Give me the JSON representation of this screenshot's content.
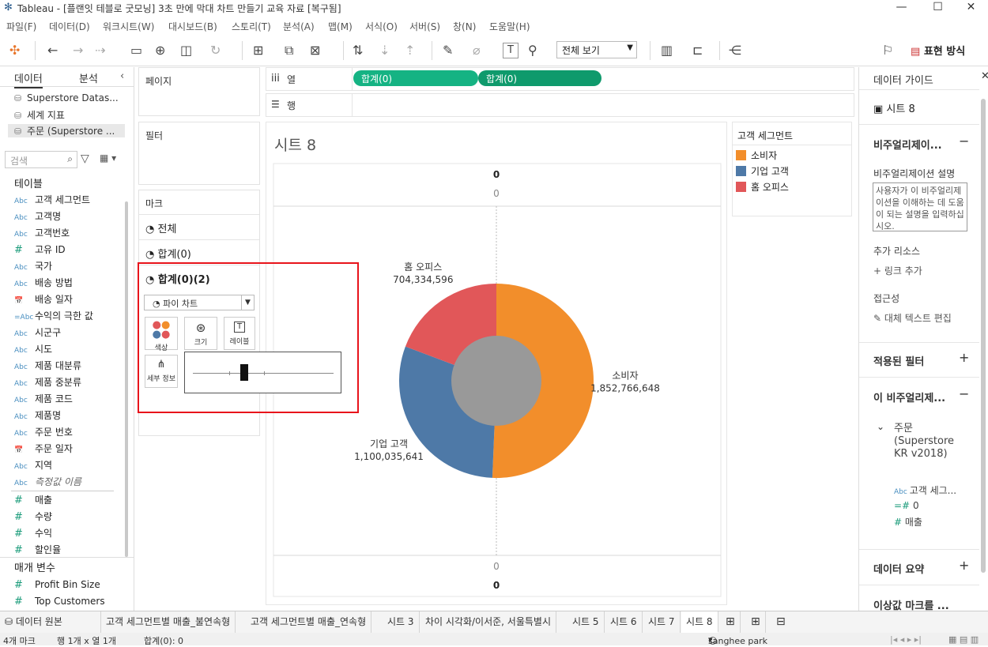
{
  "window": {
    "title": "Tableau - [플랜잇 테블로 굿모닝] 3초 만에 막대 차트 만들기 교육 자료 [복구됨]",
    "min": "—",
    "max": "☐",
    "close": "✕"
  },
  "menu": [
    "파일(F)",
    "데이터(D)",
    "워크시트(W)",
    "대시보드(B)",
    "스토리(T)",
    "분석(A)",
    "맵(M)",
    "서식(O)",
    "서버(S)",
    "창(N)",
    "도움말(H)"
  ],
  "toolbar": {
    "view_select": "전체 보기",
    "show_me": "표현 방식"
  },
  "datapane": {
    "tab_data": "데이터",
    "tab_analysis": "분석",
    "sources": [
      "Superstore Datas...",
      "세계 지표",
      "주문 (Superstore ..."
    ],
    "search_placeholder": "검색",
    "tables_header": "테이블",
    "dimensions": [
      {
        "type": "Abc",
        "name": "고객 세그먼트"
      },
      {
        "type": "Abc",
        "name": "고객명"
      },
      {
        "type": "Abc",
        "name": "고객번호"
      },
      {
        "type": "#",
        "name": "고유 ID"
      },
      {
        "type": "Abc",
        "name": "국가"
      },
      {
        "type": "Abc",
        "name": "배송 방법"
      },
      {
        "type": "📅",
        "name": "배송 일자"
      },
      {
        "type": "=Abc",
        "name": "수익의 극한 값"
      },
      {
        "type": "Abc",
        "name": "시군구"
      },
      {
        "type": "Abc",
        "name": "시도"
      },
      {
        "type": "Abc",
        "name": "제품 대분류"
      },
      {
        "type": "Abc",
        "name": "제품 중분류"
      },
      {
        "type": "Abc",
        "name": "제품 코드"
      },
      {
        "type": "Abc",
        "name": "제품명"
      },
      {
        "type": "Abc",
        "name": "주문 번호"
      },
      {
        "type": "📅",
        "name": "주문 일자"
      },
      {
        "type": "Abc",
        "name": "지역"
      },
      {
        "type": "Abc",
        "name": "측정값 이름"
      }
    ],
    "measures": [
      {
        "type": "#",
        "name": "매출"
      },
      {
        "type": "#",
        "name": "수량"
      },
      {
        "type": "#",
        "name": "수익"
      },
      {
        "type": "#",
        "name": "할인율"
      }
    ],
    "params_header": "매개 변수",
    "params": [
      {
        "type": "#",
        "name": "Profit Bin Size"
      },
      {
        "type": "#",
        "name": "Top Customers"
      }
    ]
  },
  "shelves": {
    "pages": "페이지",
    "filters": "필터",
    "marks": "마크",
    "marks_all": "전체",
    "marks_sum0": "합계(0)",
    "marks_sum0_2": "합계(0)(2)",
    "mark_type": "파이 차트",
    "btn_color": "색상",
    "btn_size": "크기",
    "btn_label": "레이블",
    "btn_detail": "세부 정보",
    "columns_label": "열",
    "rows_label": "행",
    "col_pill_1": "합계(0)",
    "col_pill_2": "합계(0)"
  },
  "view": {
    "sheet_title": "시트 8",
    "axis_top_1": "0",
    "axis_top_2": "0",
    "axis_bottom_1": "0",
    "axis_bottom_2": "0"
  },
  "chart_data": {
    "type": "pie",
    "categories": [
      "소비자",
      "기업 고객",
      "홈 오피스"
    ],
    "values": [
      1852766648,
      1100035641,
      704334596
    ],
    "value_labels": [
      "1,852,766,648",
      "1,100,035,641",
      "704,334,596"
    ],
    "colors": [
      "#f28e2b",
      "#4e79a7",
      "#e15759"
    ],
    "hole_color": "#999999",
    "legend_title": "고객 세그먼트",
    "legend_position": "right"
  },
  "rightpane": {
    "title": "데이터 가이드",
    "sheet": "시트 8",
    "viz_section": "비주얼리제이...",
    "viz_desc_label": "비주얼리제이션 설명",
    "viz_desc_placeholder": "사용자가 이 비주얼리제이션을 이해하는 데 도움이 되는 설명을 입력하십시오.",
    "extra_resources": "추가 리소스",
    "add_link": "링크 추가",
    "accessibility": "접근성",
    "edit_alt": "대체 텍스트 편집",
    "applied_filters": "적용된 필터",
    "this_viz": "이 비주얼리제...",
    "source_name": "주문 (Superstore KR v2018)",
    "field_1": "고객 세그...",
    "field_2": "0",
    "field_3": "매출",
    "data_summary": "데이터 요약",
    "outlier": "이상값 마크를 ..."
  },
  "tabs": [
    "데이터 원본",
    "고객 세그먼트별 매출_불연속형",
    "고객 세그먼트별 매출_연속형",
    "시트 3",
    "차이 시각화/이서준, 서울특별시",
    "시트 5",
    "시트 6",
    "시트 7",
    "시트 8"
  ],
  "status": {
    "marks": "4개 마크",
    "rowcol": "행 1개 x 열 1개",
    "sum": "합계(0): 0",
    "user": "sanghee park"
  }
}
